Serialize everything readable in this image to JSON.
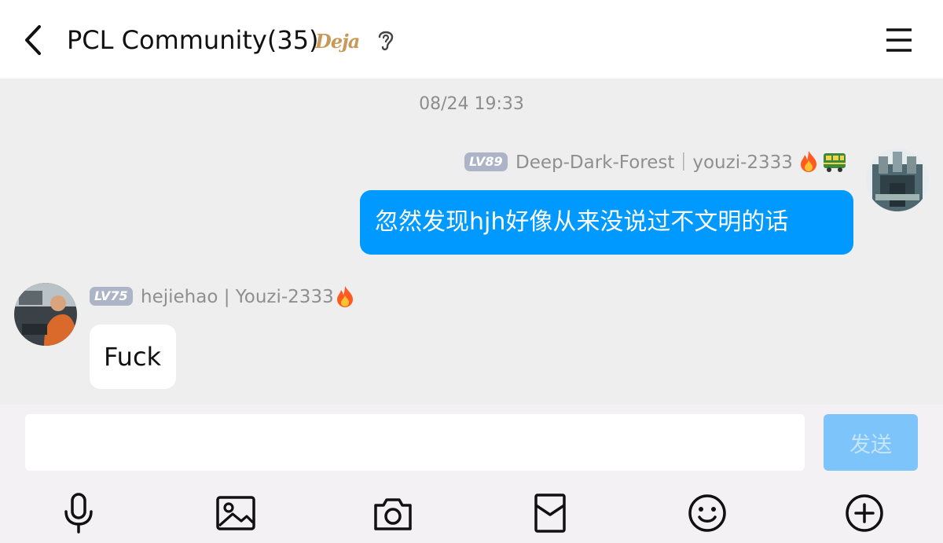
{
  "header": {
    "back_icon": "chevron-left-icon",
    "title": "PCL Community(35)",
    "badge_text": "Deja",
    "ear_icon": "ear-icon",
    "menu_icon": "hamburger-menu-icon"
  },
  "chat": {
    "timestamp": "08/24 19:33",
    "messages": [
      {
        "direction": "outgoing",
        "level": "LV89",
        "sender": "Deep-Dark-Forest｜youzi-2333",
        "badges": [
          "fire-icon",
          "train-icon"
        ],
        "text": "忽然发现hjh好像从来没说过不文明的话",
        "avatar": "castle-avatar"
      },
      {
        "direction": "incoming",
        "level": "LV75",
        "sender": "hejiehao | Youzi-2333",
        "badges": [
          "fire-icon"
        ],
        "text": "Fuck",
        "avatar": "person-avatar"
      }
    ]
  },
  "footer": {
    "input_value": "",
    "send_label": "发送",
    "tools": [
      "microphone-icon",
      "image-icon",
      "camera-icon",
      "red-packet-icon",
      "emoji-icon",
      "plus-circle-icon"
    ]
  },
  "colors": {
    "bubble_outgoing": "#0099ff",
    "send_button": "#7cc4fa",
    "level_badge": "#aeb4c7",
    "chat_background": "#eeeeee"
  }
}
